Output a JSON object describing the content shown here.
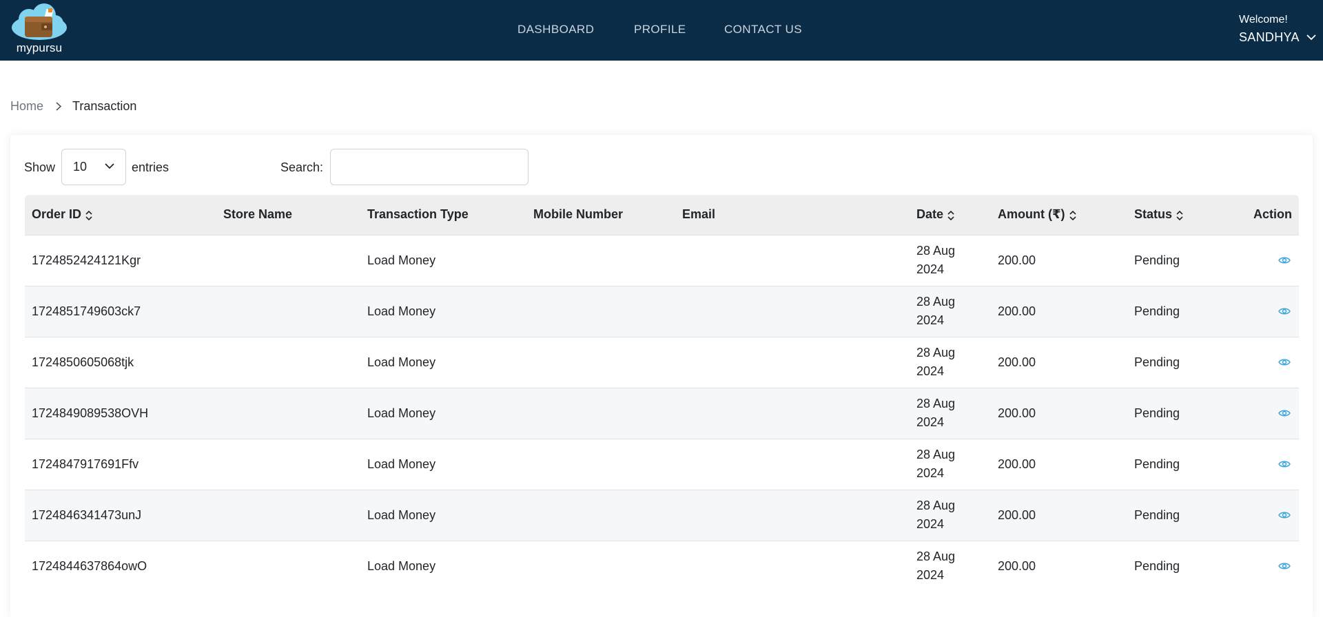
{
  "header": {
    "logo_text": "mypursu",
    "nav": [
      {
        "label": "DASHBOARD"
      },
      {
        "label": "PROFILE"
      },
      {
        "label": "CONTACT US"
      }
    ],
    "welcome": "Welcome!",
    "user_name": "SANDHYA"
  },
  "breadcrumb": {
    "home": "Home",
    "current": "Transaction"
  },
  "controls": {
    "show_label": "Show",
    "entries_value": "10",
    "entries_label": "entries",
    "search_label": "Search:",
    "search_value": ""
  },
  "table": {
    "columns": [
      {
        "label": "Order ID",
        "sortable": true
      },
      {
        "label": "Store Name",
        "sortable": false
      },
      {
        "label": "Transaction Type",
        "sortable": false
      },
      {
        "label": "Mobile Number",
        "sortable": false
      },
      {
        "label": "Email",
        "sortable": false
      },
      {
        "label": "Date",
        "sortable": true
      },
      {
        "label": "Amount (₹)",
        "sortable": true
      },
      {
        "label": "Status",
        "sortable": true
      },
      {
        "label": "Action",
        "sortable": false
      }
    ],
    "rows": [
      {
        "order_id": "1724852424121Kgr",
        "store": "",
        "type": "Load Money",
        "mobile": "",
        "email": "",
        "date_line1": "28 Aug",
        "date_line2": "2024",
        "amount": "200.00",
        "status": "Pending",
        "action_icon": "eye-icon"
      },
      {
        "order_id": "1724851749603ck7",
        "store": "",
        "type": "Load Money",
        "mobile": "",
        "email": "",
        "date_line1": "28 Aug",
        "date_line2": "2024",
        "amount": "200.00",
        "status": "Pending",
        "action_icon": "eye-icon"
      },
      {
        "order_id": "1724850605068tjk",
        "store": "",
        "type": "Load Money",
        "mobile": "",
        "email": "",
        "date_line1": "28 Aug",
        "date_line2": "2024",
        "amount": "200.00",
        "status": "Pending",
        "action_icon": "eye-icon"
      },
      {
        "order_id": "1724849089538OVH",
        "store": "",
        "type": "Load Money",
        "mobile": "",
        "email": "",
        "date_line1": "28 Aug",
        "date_line2": "2024",
        "amount": "200.00",
        "status": "Pending",
        "action_icon": "eye-icon"
      },
      {
        "order_id": "1724847917691Ffv",
        "store": "",
        "type": "Load Money",
        "mobile": "",
        "email": "",
        "date_line1": "28 Aug",
        "date_line2": "2024",
        "amount": "200.00",
        "status": "Pending",
        "action_icon": "eye-icon"
      },
      {
        "order_id": "1724846341473unJ",
        "store": "",
        "type": "Load Money",
        "mobile": "",
        "email": "",
        "date_line1": "28 Aug",
        "date_line2": "2024",
        "amount": "200.00",
        "status": "Pending",
        "action_icon": "eye-icon"
      },
      {
        "order_id": "1724844637864owO",
        "store": "",
        "type": "Load Money",
        "mobile": "",
        "email": "",
        "date_line1": "28 Aug",
        "date_line2": "2024",
        "amount": "200.00",
        "status": "Pending",
        "action_icon": "eye-icon"
      }
    ]
  },
  "colors": {
    "header_bg": "#0b2c47",
    "accent_icon": "#3aa6dd",
    "table_header_bg": "#eeeeee",
    "row_stripe": "#f5f7f9"
  }
}
